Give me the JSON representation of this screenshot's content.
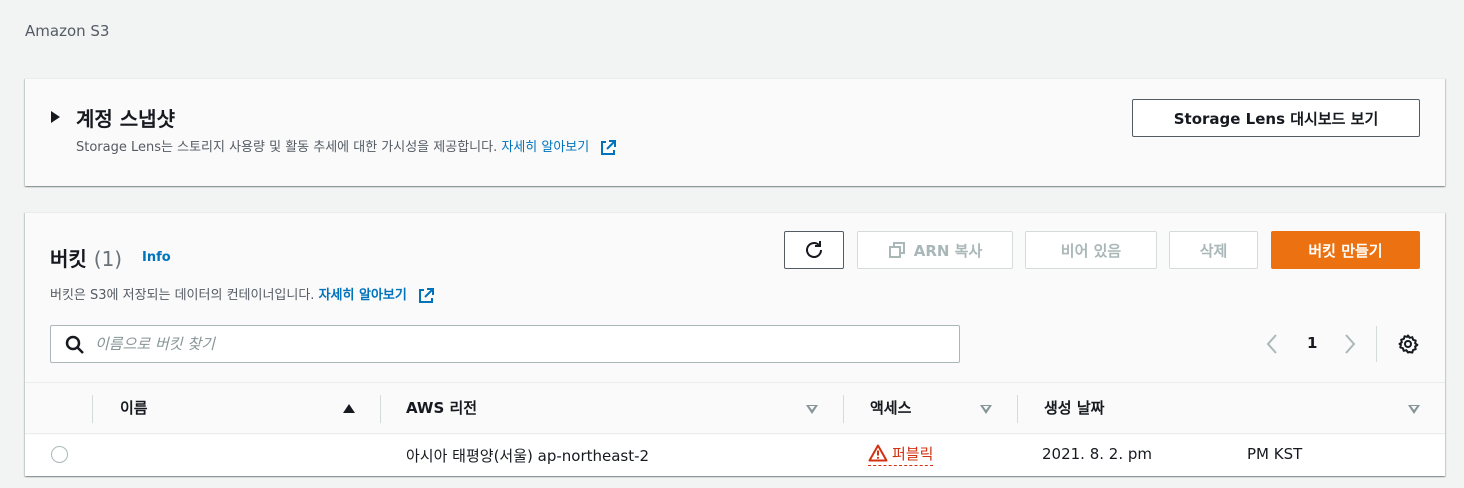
{
  "breadcrumb": "Amazon S3",
  "snapshot": {
    "title": "계정 스냅샷",
    "description": "Storage Lens는 스토리지 사용량 및 활동 추세에 대한 가시성을 제공합니다.",
    "learn_more": "자세히 알아보기",
    "lens_button": "Storage Lens 대시보드 보기"
  },
  "buckets": {
    "title": "버킷",
    "count": "(1)",
    "info": "Info",
    "description": "버킷은 S3에 저장되는 데이터의 컨테이너입니다.",
    "learn_more": "자세히 알아보기",
    "buttons": {
      "arn": "ARN 복사",
      "empty": "비어 있음",
      "delete": "삭제",
      "create": "버킷 만들기"
    },
    "search_placeholder": "이름으로 버킷 찾기",
    "page": "1",
    "columns": [
      "이름",
      "AWS 리전",
      "액세스",
      "생성 날짜"
    ],
    "rows": [
      {
        "name": "",
        "region": "아시아 태평양(서울) ap-northeast-2",
        "access": "퍼블릭",
        "created_a": "2021. 8. 2. pm",
        "created_b": "PM KST"
      }
    ]
  },
  "colors": {
    "primary": "#ec7211",
    "link": "#0073bb",
    "public_warning": "#d13212"
  },
  "icons": [
    "external-link-icon",
    "refresh-icon",
    "copy-icon",
    "search-icon",
    "chevron-left-icon",
    "chevron-right-icon",
    "settings-icon",
    "warning-icon",
    "sort-ascending-icon",
    "sort-icon"
  ]
}
